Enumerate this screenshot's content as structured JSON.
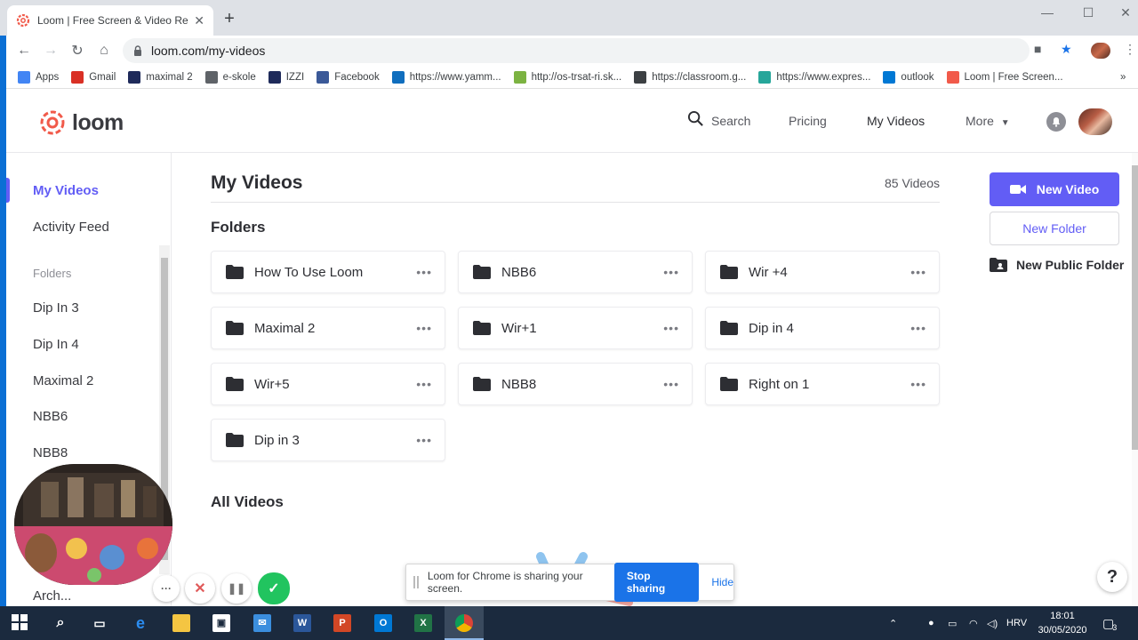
{
  "browser": {
    "tab_title": "Loom | Free Screen & Video Rec",
    "url": "loom.com/my-videos",
    "new_tab_label": "+",
    "bookmarks": [
      {
        "label": "Apps",
        "icon": "apps-grid-icon",
        "color": "#4285f4"
      },
      {
        "label": "Gmail",
        "icon": "gmail-icon",
        "color": "#d93025"
      },
      {
        "label": "maximal 2",
        "icon": "bookmark-icon",
        "color": "#1e2a5a"
      },
      {
        "label": "e-skole",
        "icon": "globe-icon",
        "color": "#5f6368"
      },
      {
        "label": "IZZI",
        "icon": "izzi-icon",
        "color": "#1e2a5a"
      },
      {
        "label": "Facebook",
        "icon": "facebook-icon",
        "color": "#3b5998"
      },
      {
        "label": "https://www.yamm...",
        "icon": "yammer-icon",
        "color": "#106ebe"
      },
      {
        "label": "http://os-trsat-ri.sk...",
        "icon": "shield-icon",
        "color": "#7cb342"
      },
      {
        "label": "https://classroom.g...",
        "icon": "classroom-icon",
        "color": "#3c4043"
      },
      {
        "label": "https://www.expres...",
        "icon": "paper-plane-icon",
        "color": "#26a69a"
      },
      {
        "label": "outlook",
        "icon": "outlook-icon",
        "color": "#0078d4"
      },
      {
        "label": "Loom | Free Screen...",
        "icon": "loom-icon",
        "color": "#f15a4a"
      }
    ],
    "more_bookmarks": "»"
  },
  "header": {
    "logo_text": "loom",
    "search_label": "Search",
    "pricing_label": "Pricing",
    "my_videos_label": "My Videos",
    "more_label": "More"
  },
  "sidebar": {
    "my_videos": "My Videos",
    "activity_feed": "Activity Feed",
    "folders_heading": "Folders",
    "folders": [
      "Dip In 3",
      "Dip In 4",
      "Maximal 2",
      "NBB6",
      "NBB8"
    ],
    "archive_label": "Arch..."
  },
  "main": {
    "title": "My Videos",
    "video_count": "85 Videos",
    "folders_heading": "Folders",
    "all_videos_heading": "All Videos",
    "folders": [
      {
        "name": "How To Use Loom"
      },
      {
        "name": "NBB6"
      },
      {
        "name": "Wir +4"
      },
      {
        "name": "Maximal 2"
      },
      {
        "name": "Wir+1"
      },
      {
        "name": "Dip in 4"
      },
      {
        "name": "Wir+5"
      },
      {
        "name": "NBB8"
      },
      {
        "name": "Right on 1"
      },
      {
        "name": "Dip in 3"
      }
    ],
    "more_dots": "•••"
  },
  "actions": {
    "new_video": "New Video",
    "new_folder": "New Folder",
    "new_public_folder": "New Public Folder"
  },
  "share_bar": {
    "message": "Loom for Chrome is sharing your screen.",
    "stop": "Stop sharing",
    "hide": "Hide"
  },
  "help_label": "?",
  "recorder": {
    "more": "···",
    "cancel": "✕",
    "pause": "❚❚",
    "finish": "✓"
  },
  "taskbar": {
    "language": "HRV",
    "time": "18:01",
    "date": "30/05/2020",
    "notifications": "3"
  },
  "colors": {
    "accent": "#625df5",
    "loom_red": "#f15a4a",
    "taskbar": "#1b2a3e",
    "chrome_blue": "#1a73e8"
  }
}
